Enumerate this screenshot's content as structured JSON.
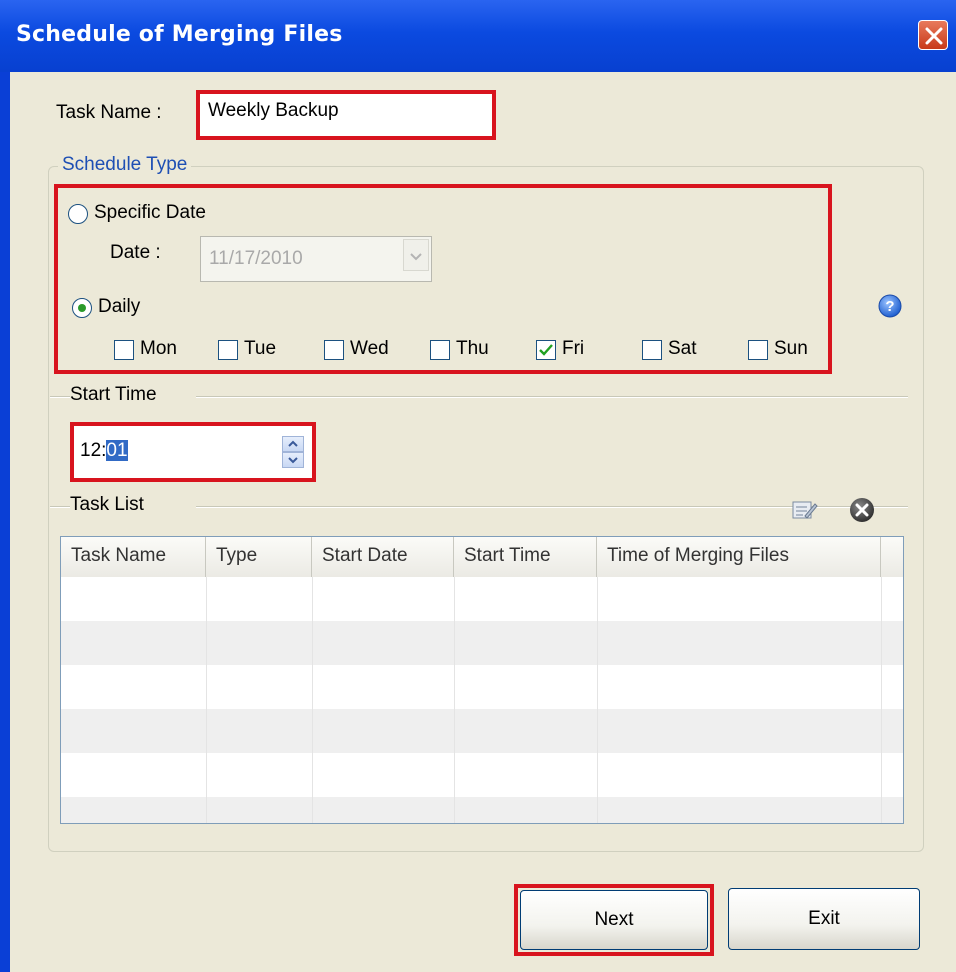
{
  "window": {
    "title": "Schedule of Merging Files"
  },
  "task_name": {
    "label": "Task Name :",
    "value": "Weekly Backup"
  },
  "schedule_type": {
    "legend": "Schedule Type",
    "specific_date_label": "Specific Date",
    "date_label": "Date :",
    "date_value": "11/17/2010",
    "daily_label": "Daily",
    "selected": "Daily",
    "days": [
      {
        "label": "Mon",
        "checked": false
      },
      {
        "label": "Tue",
        "checked": false
      },
      {
        "label": "Wed",
        "checked": false
      },
      {
        "label": "Thu",
        "checked": false
      },
      {
        "label": "Fri",
        "checked": true
      },
      {
        "label": "Sat",
        "checked": false
      },
      {
        "label": "Sun",
        "checked": false
      }
    ]
  },
  "start_time": {
    "legend": "Start Time",
    "hour": "12:",
    "minute": "01"
  },
  "task_list": {
    "legend": "Task List",
    "columns": [
      "Task Name",
      "Type",
      "Start Date",
      "Start Time",
      "Time of Merging Files"
    ],
    "rows": []
  },
  "buttons": {
    "next": "Next",
    "exit": "Exit"
  },
  "icons": {
    "help": "help-icon",
    "edit": "edit-task-icon",
    "delete": "delete-task-icon",
    "close": "close-icon"
  }
}
